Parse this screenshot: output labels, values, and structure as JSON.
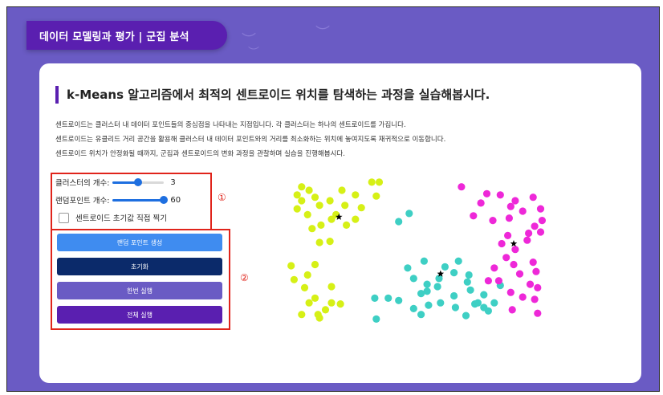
{
  "page": {
    "banner_title": "데이터 모델링과 평가 | 군집 분석",
    "heading": "k-Means 알고리즘에서 최적의 센트로이드 위치를 탐색하는 과정을 실습해봅시다.",
    "description": [
      "센트로이드는 클러스터 내 데이터 포인트들의 중심점을 나타내는 지점입니다. 각 클러스터는 하나의 센트로이드를 가집니다.",
      "센트로이드는 유클리드 거리 공간을 활용해 클러스터 내 데이터 포인트와의 거리를 최소화하는 위치에 놓여지도록 재귀적으로 이동합니다.",
      "센트로이드 위치가 안정화될 때까지, 군집과 센트로이드의 변화 과정을 관찰하며 실습을 진행해봅시다."
    ]
  },
  "controls": {
    "clusters": {
      "label": "클러스터의 개수:",
      "value": "3",
      "fraction": 0.5
    },
    "points": {
      "label": "랜덤포인트 개수:",
      "value": "60",
      "fraction": 1.0
    },
    "manual_centroid": {
      "label": "센트로이드 초기값 직접 찍기",
      "checked": false
    }
  },
  "annotations": {
    "controls": "①",
    "buttons": "②"
  },
  "buttons": [
    {
      "label": "랜덤 포인트 생성",
      "color": "#3f8cf0"
    },
    {
      "label": "초기화",
      "color": "#0b2a6a"
    },
    {
      "label": "한번 실행",
      "color": "#6a5bc4"
    },
    {
      "label": "전체 실행",
      "color": "#5a1fb0"
    }
  ],
  "colors": {
    "cluster_a": "#d6f016",
    "cluster_b": "#3ecfc4",
    "cluster_c": "#ee28d8",
    "centroid": "#000000",
    "frame_bg": "#6a5bc4",
    "accent": "#5a1fb0"
  },
  "scatter": {
    "clusters": [
      {
        "name": "",
        "color": "#d6f016",
        "points": [
          [
            -4.7,
            2.55
          ],
          [
            -4.55,
            2.9
          ],
          [
            -4.3,
            2.75
          ],
          [
            -4.55,
            2.3
          ],
          [
            -4.7,
            1.95
          ],
          [
            -4.35,
            1.7
          ],
          [
            -4.1,
            2.45
          ],
          [
            -3.95,
            2.1
          ],
          [
            -4.2,
            1.1
          ],
          [
            -3.9,
            1.25
          ],
          [
            -3.55,
            1.5
          ],
          [
            -3.4,
            1.7
          ],
          [
            -3.6,
            2.3
          ],
          [
            -3.1,
            2.1
          ],
          [
            -3.2,
            2.75
          ],
          [
            -3.05,
            1.25
          ],
          [
            -2.75,
            2.55
          ],
          [
            -2.55,
            2.0
          ],
          [
            -2.75,
            1.5
          ],
          [
            -2.2,
            3.1
          ],
          [
            -1.95,
            3.1
          ],
          [
            -2.05,
            2.5
          ],
          [
            -3.95,
            0.5
          ],
          [
            -3.6,
            0.55
          ],
          [
            -4.35,
            -0.9
          ],
          [
            -4.1,
            -0.45
          ],
          [
            -3.55,
            -1.4
          ],
          [
            -4.3,
            -2.1
          ],
          [
            -4.55,
            -2.6
          ],
          [
            -4.0,
            -2.6
          ],
          [
            -4.1,
            -1.9
          ],
          [
            -3.55,
            -2.1
          ],
          [
            -3.75,
            -2.4
          ],
          [
            -4.8,
            -1.1
          ],
          [
            -4.9,
            -0.5
          ],
          [
            -4.45,
            -1.45
          ],
          [
            -3.95,
            -2.75
          ],
          [
            -3.25,
            -2.15
          ]
        ]
      },
      {
        "name": "",
        "color": "#3ecfc4",
        "points": [
          [
            -1.3,
            1.4
          ],
          [
            -0.95,
            1.75
          ],
          [
            -1.0,
            -0.6
          ],
          [
            -0.45,
            -0.3
          ],
          [
            -0.8,
            -1.05
          ],
          [
            -0.35,
            -1.3
          ],
          [
            -0.55,
            -1.7
          ],
          [
            -0.35,
            -1.6
          ],
          [
            0.05,
            -1.05
          ],
          [
            0.0,
            -1.4
          ],
          [
            0.55,
            -0.8
          ],
          [
            0.25,
            -0.55
          ],
          [
            0.7,
            -0.3
          ],
          [
            1.05,
            -0.9
          ],
          [
            1.0,
            -1.2
          ],
          [
            1.25,
            -2.15
          ],
          [
            1.55,
            -2.3
          ],
          [
            1.35,
            -2.1
          ],
          [
            1.55,
            -1.75
          ],
          [
            1.1,
            -1.55
          ],
          [
            0.55,
            -1.8
          ],
          [
            -1.65,
            -1.9
          ],
          [
            -2.1,
            -1.9
          ],
          [
            -1.3,
            -2.0
          ],
          [
            -2.05,
            -2.8
          ],
          [
            -0.8,
            -2.35
          ],
          [
            -0.3,
            -2.2
          ],
          [
            -0.55,
            -2.6
          ],
          [
            0.6,
            -2.3
          ],
          [
            0.95,
            -2.65
          ],
          [
            0.1,
            -2.1
          ],
          [
            1.9,
            -2.1
          ],
          [
            1.7,
            -2.45
          ],
          [
            2.1,
            -1.35
          ]
        ]
      },
      {
        "name": "",
        "color": "#ee28d8",
        "points": [
          [
            0.8,
            2.9
          ],
          [
            1.65,
            2.6
          ],
          [
            1.45,
            2.2
          ],
          [
            2.1,
            2.55
          ],
          [
            2.6,
            2.3
          ],
          [
            2.45,
            2.05
          ],
          [
            3.2,
            2.45
          ],
          [
            3.45,
            1.95
          ],
          [
            1.2,
            1.65
          ],
          [
            1.85,
            1.45
          ],
          [
            2.4,
            1.55
          ],
          [
            2.85,
            1.85
          ],
          [
            3.25,
            1.2
          ],
          [
            3.45,
            0.95
          ],
          [
            2.35,
            0.8
          ],
          [
            3.0,
            0.6
          ],
          [
            2.6,
            0.2
          ],
          [
            2.15,
            0.45
          ],
          [
            2.3,
            -0.15
          ],
          [
            2.55,
            -0.45
          ],
          [
            3.2,
            -0.35
          ],
          [
            2.75,
            -0.85
          ],
          [
            3.1,
            -1.3
          ],
          [
            3.35,
            -1.45
          ],
          [
            2.85,
            -1.85
          ],
          [
            3.25,
            -1.95
          ],
          [
            2.45,
            -1.65
          ],
          [
            2.05,
            -1.15
          ],
          [
            1.7,
            -1.15
          ],
          [
            1.9,
            -0.6
          ],
          [
            2.5,
            -2.4
          ],
          [
            3.35,
            -2.55
          ],
          [
            3.3,
            -0.75
          ],
          [
            3.05,
            0.9
          ],
          [
            3.5,
            1.45
          ]
        ]
      }
    ],
    "centroids": [
      [
        -3.3,
        1.6
      ],
      [
        0.1,
        -0.85
      ],
      [
        2.55,
        0.45
      ]
    ]
  }
}
